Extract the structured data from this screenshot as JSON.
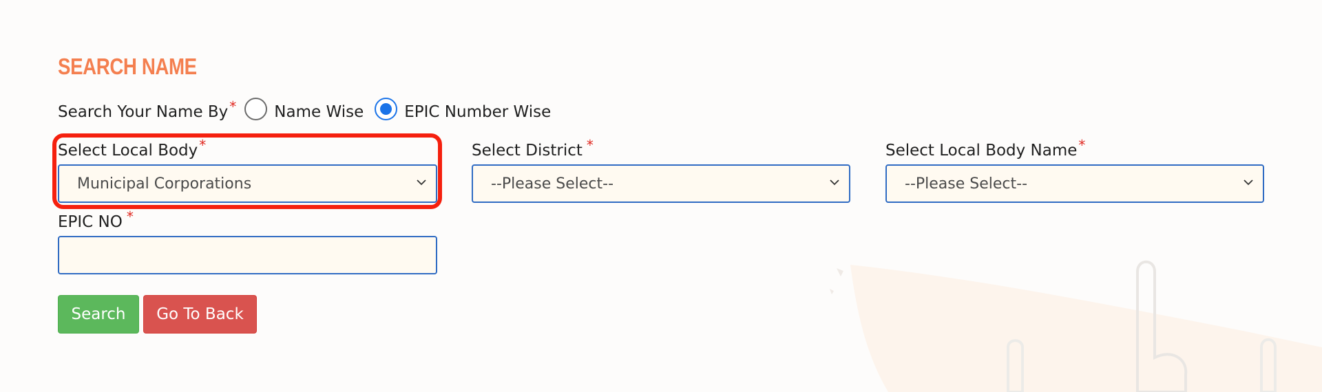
{
  "header": {
    "title": "SEARCH NAME"
  },
  "search_by": {
    "label": "Search Your Name By",
    "required_mark": "*",
    "options": [
      {
        "label": "Name Wise",
        "selected": false
      },
      {
        "label": "EPIC Number Wise",
        "selected": true
      }
    ]
  },
  "fields": {
    "local_body": {
      "label": "Select Local Body",
      "required_mark": "*",
      "value": "Municipal Corporations",
      "highlighted": true
    },
    "district": {
      "label": "Select District",
      "required_mark": "*",
      "value": "--Please Select--"
    },
    "local_body_name": {
      "label": "Select Local Body Name",
      "required_mark": "*",
      "value": "--Please Select--"
    },
    "epic_no": {
      "label": "EPIC NO",
      "required_mark": "*",
      "value": "",
      "placeholder": ""
    }
  },
  "buttons": {
    "search": "Search",
    "back": "Go To Back"
  },
  "colors": {
    "title": "#f47f4f",
    "required": "#e0271f",
    "field_border": "#2f6bc3",
    "field_bg": "#fffaf1",
    "radio_selected": "#1a73e8",
    "highlight": "#f5200e",
    "search_button": "#5cb85c",
    "back_button": "#d9534f"
  }
}
